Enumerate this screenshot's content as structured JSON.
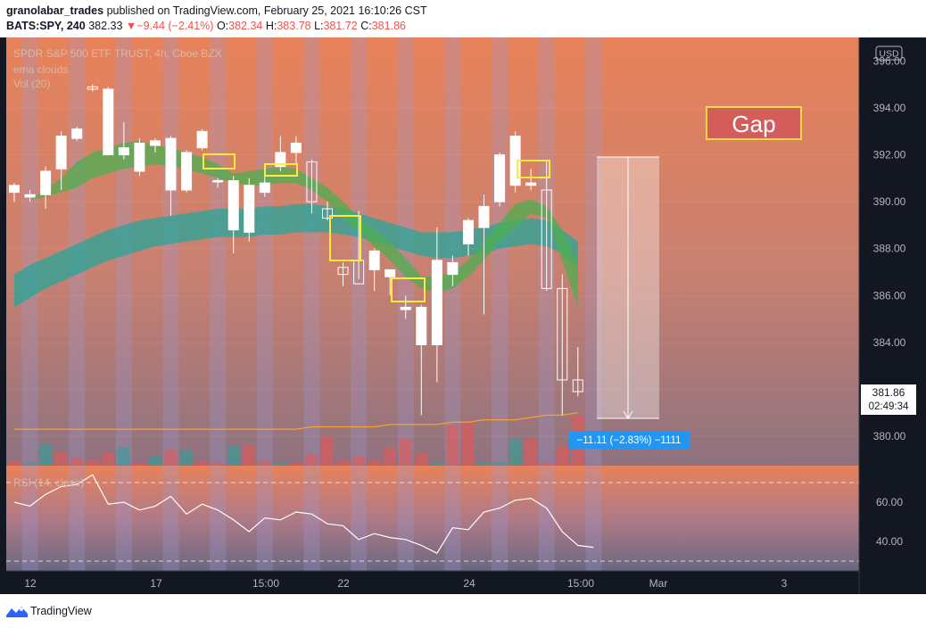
{
  "header": {
    "author": "granolabar_trades",
    "published_text": "published on TradingView.com, February 25, 2021 16:10:26 CST",
    "symbol": "BATS:SPY, 240",
    "last": "382.33",
    "arrow": "▼",
    "change": "−9.44 (−2.41%)",
    "o_label": "O:",
    "o_value": "382.34",
    "h_label": "H:",
    "h_value": "383.78",
    "l_label": "L:",
    "l_value": "381.72",
    "c_label": "C:",
    "c_value": "381.86"
  },
  "legend": {
    "title": "SPDR S&P 500 ETF TRUST, 4h, Cboe BZX",
    "indicator1": "ema clouds",
    "indicator2": "Vol (20)",
    "rsi": "RSI (14, close)"
  },
  "currency_badge": "USD",
  "annotation_gap": "Gap",
  "measure_label": "−11.11 (−2.83%) −1111",
  "price_badge": {
    "price": "381.86",
    "countdown": "02:49:34"
  },
  "footer": {
    "brand": "TradingView"
  },
  "colors": {
    "up": "#ffffff",
    "down": "#ffffff",
    "ema_fast": "#4caf50",
    "ema_slow": "#26a69a",
    "highlight": "#ffeb3b",
    "measure": "#2196f3"
  },
  "chart_data": {
    "type": "candlestick",
    "y_axis_ticks": [
      "394.00",
      "392.00",
      "390.00",
      "388.00",
      "386.00",
      "384.00",
      "380.00"
    ],
    "y_axis_top_tick": "396.00",
    "rsi_ticks": [
      "60.00",
      "40.00"
    ],
    "x_axis_ticks": [
      "12",
      "17",
      "15:00",
      "22",
      "24",
      "15:00",
      "Mar",
      "3"
    ],
    "ylim": [
      378.5,
      396.5
    ],
    "candles": [
      {
        "o": 390.4,
        "h": 390.8,
        "l": 390.0,
        "c": 390.7
      },
      {
        "o": 390.2,
        "h": 390.5,
        "l": 390.0,
        "c": 390.3
      },
      {
        "o": 390.3,
        "h": 391.5,
        "l": 389.7,
        "c": 391.3
      },
      {
        "o": 391.4,
        "h": 393.0,
        "l": 390.5,
        "c": 392.8
      },
      {
        "o": 392.7,
        "h": 393.2,
        "l": 392.6,
        "c": 393.1
      },
      {
        "o": 394.9,
        "h": 395.0,
        "l": 394.7,
        "c": 394.8
      },
      {
        "o": 392.0,
        "h": 394.9,
        "l": 392.0,
        "c": 394.8
      },
      {
        "o": 392.0,
        "h": 393.4,
        "l": 391.8,
        "c": 392.3
      },
      {
        "o": 391.3,
        "h": 392.7,
        "l": 391.1,
        "c": 392.5
      },
      {
        "o": 392.4,
        "h": 392.7,
        "l": 392.1,
        "c": 392.6
      },
      {
        "o": 390.5,
        "h": 392.8,
        "l": 389.4,
        "c": 392.7
      },
      {
        "o": 390.5,
        "h": 392.2,
        "l": 390.4,
        "c": 392.1
      },
      {
        "o": 392.3,
        "h": 393.1,
        "l": 392.2,
        "c": 393.0
      },
      {
        "o": 390.9,
        "h": 391.0,
        "l": 390.6,
        "c": 390.9
      },
      {
        "o": 388.8,
        "h": 391.1,
        "l": 387.8,
        "c": 390.9
      },
      {
        "o": 388.7,
        "h": 391.0,
        "l": 388.3,
        "c": 390.7
      },
      {
        "o": 390.4,
        "h": 391.5,
        "l": 390.2,
        "c": 390.8
      },
      {
        "o": 391.5,
        "h": 392.8,
        "l": 391.3,
        "c": 392.1
      },
      {
        "o": 392.1,
        "h": 392.8,
        "l": 391.6,
        "c": 392.5
      },
      {
        "o": 391.7,
        "h": 391.8,
        "l": 389.5,
        "c": 390.0
      },
      {
        "o": 389.7,
        "h": 390.0,
        "l": 389.2,
        "c": 389.3
      },
      {
        "o": 387.2,
        "h": 387.4,
        "l": 386.4,
        "c": 386.9
      },
      {
        "o": 387.5,
        "h": 389.6,
        "l": 386.7,
        "c": 386.5
      },
      {
        "o": 387.1,
        "h": 388.0,
        "l": 386.2,
        "c": 387.9
      },
      {
        "o": 386.8,
        "h": 387.1,
        "l": 386.0,
        "c": 387.1
      },
      {
        "o": 385.4,
        "h": 386.0,
        "l": 385.0,
        "c": 385.5
      },
      {
        "o": 383.9,
        "h": 385.6,
        "l": 380.9,
        "c": 385.5
      },
      {
        "o": 383.9,
        "h": 388.9,
        "l": 382.3,
        "c": 387.5
      },
      {
        "o": 386.9,
        "h": 387.7,
        "l": 386.4,
        "c": 387.4
      },
      {
        "o": 388.2,
        "h": 389.3,
        "l": 387.7,
        "c": 389.2
      },
      {
        "o": 388.9,
        "h": 390.3,
        "l": 385.2,
        "c": 389.8
      },
      {
        "o": 390.0,
        "h": 392.1,
        "l": 389.8,
        "c": 392.0
      },
      {
        "o": 390.7,
        "h": 393.0,
        "l": 390.4,
        "c": 392.8
      },
      {
        "o": 390.7,
        "h": 391.4,
        "l": 390.5,
        "c": 390.8
      },
      {
        "o": 390.5,
        "h": 391.8,
        "l": 386.2,
        "c": 386.3
      },
      {
        "o": 386.3,
        "h": 386.9,
        "l": 380.9,
        "c": 382.4
      },
      {
        "o": 382.4,
        "h": 383.8,
        "l": 381.7,
        "c": 381.9
      }
    ],
    "volume_colors": [
      "r",
      "g",
      "g",
      "r",
      "r",
      "r",
      "r",
      "g",
      "r",
      "g",
      "r",
      "g",
      "r",
      "r",
      "g",
      "r",
      "r",
      "g",
      "r",
      "r",
      "r",
      "r",
      "r",
      "r",
      "r",
      "r",
      "r",
      "g",
      "r",
      "r",
      "g",
      "g",
      "g",
      "r",
      "r",
      "r",
      "r"
    ],
    "volume": [
      3,
      2,
      14,
      8,
      5,
      4,
      8,
      12,
      2,
      6,
      10,
      10,
      3,
      2,
      13,
      13,
      3,
      2,
      2,
      7,
      19,
      4,
      6,
      4,
      12,
      17,
      8,
      2,
      26,
      28,
      2,
      2,
      17,
      17,
      2,
      13,
      32
    ],
    "volume_ma": [
      380.3,
      380.3,
      380.3,
      380.3,
      380.3,
      380.3,
      380.3,
      380.3,
      380.3,
      380.3,
      380.3,
      380.3,
      380.3,
      380.3,
      380.3,
      380.3,
      380.3,
      380.3,
      380.3,
      380.4,
      380.4,
      380.4,
      380.4,
      380.4,
      380.5,
      380.5,
      380.5,
      380.5,
      380.6,
      380.6,
      380.7,
      380.7,
      380.7,
      380.8,
      380.9,
      380.9,
      381.0
    ],
    "ema_fast_upper": [
      390.0,
      390.1,
      390.5,
      391.0,
      391.7,
      392.1,
      392.3,
      392.5,
      392.6,
      392.4,
      392.3,
      392.1,
      391.9,
      391.6,
      391.2,
      391.3,
      391.4,
      391.5,
      391.4,
      391.0,
      390.6,
      390.0,
      389.3,
      388.8,
      388.3,
      387.6,
      386.8,
      386.8,
      387.0,
      387.5,
      388.3,
      389.1,
      389.9,
      390.1,
      389.8,
      388.8,
      387.4
    ],
    "ema_fast_lower": [
      390.0,
      390.1,
      390.2,
      390.4,
      390.6,
      391.0,
      391.2,
      391.4,
      391.5,
      391.6,
      391.5,
      391.4,
      391.2,
      391.0,
      390.8,
      390.7,
      390.7,
      390.8,
      390.8,
      390.5,
      390.0,
      389.3,
      388.7,
      388.1,
      387.5,
      386.8,
      386.3,
      386.1,
      386.3,
      386.8,
      387.5,
      388.3,
      388.9,
      389.5,
      389.3,
      387.5,
      385.5
    ],
    "ema_slow_upper": [
      386.9,
      387.3,
      387.6,
      387.9,
      388.2,
      388.5,
      388.8,
      389.0,
      389.2,
      389.3,
      389.4,
      389.5,
      389.6,
      389.7,
      389.7,
      389.7,
      389.8,
      389.8,
      389.9,
      389.9,
      389.8,
      389.7,
      389.5,
      389.3,
      389.1,
      388.9,
      388.7,
      388.7,
      388.7,
      388.8,
      388.9,
      389.1,
      389.2,
      389.3,
      389.2,
      388.8,
      388.3
    ],
    "ema_slow_lower": [
      385.5,
      385.9,
      386.3,
      386.6,
      386.9,
      387.2,
      387.5,
      387.7,
      387.9,
      388.1,
      388.2,
      388.3,
      388.4,
      388.5,
      388.5,
      388.5,
      388.6,
      388.6,
      388.7,
      388.7,
      388.7,
      388.6,
      388.5,
      388.3,
      388.1,
      387.9,
      387.7,
      387.6,
      387.6,
      387.7,
      387.8,
      388.0,
      388.1,
      388.2,
      388.1,
      387.8,
      387.2
    ],
    "rsi": [
      60,
      58,
      64,
      68,
      69,
      74,
      59,
      60,
      56,
      58,
      63,
      54,
      59,
      56,
      51,
      45,
      52,
      51,
      55,
      54,
      49,
      48,
      41,
      44,
      42,
      41,
      38,
      34,
      47,
      46,
      55,
      57,
      61,
      62,
      57,
      45,
      38,
      37
    ]
  }
}
